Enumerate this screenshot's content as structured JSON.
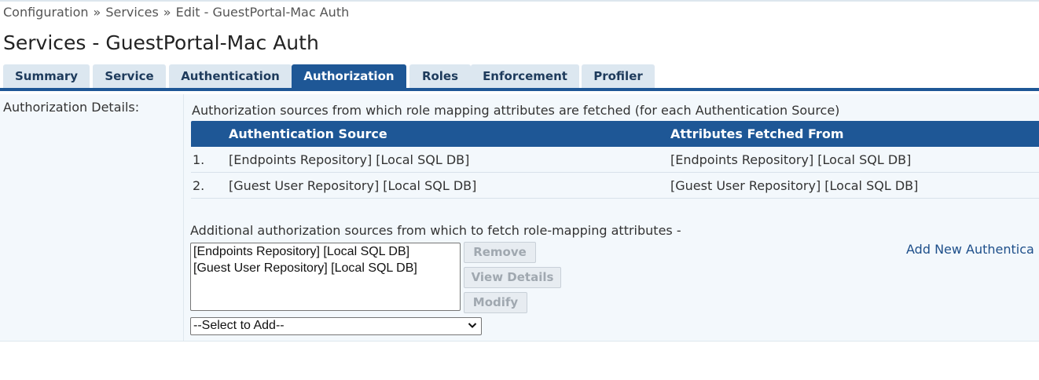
{
  "breadcrumb": {
    "items": [
      "Configuration",
      "Services",
      "Edit - GuestPortal-Mac Auth"
    ],
    "separator": "»"
  },
  "page_title": "Services - GuestPortal-Mac Auth",
  "tabs": [
    {
      "label": "Summary",
      "active": false
    },
    {
      "label": "Service",
      "active": false
    },
    {
      "label": "Authentication",
      "active": false
    },
    {
      "label": "Authorization",
      "active": true
    },
    {
      "label": "Roles",
      "active": false
    },
    {
      "label": "Enforcement",
      "active": false
    },
    {
      "label": "Profiler",
      "active": false
    }
  ],
  "authorization": {
    "section_label": "Authorization Details:",
    "intro": "Authorization sources from which role mapping attributes are fetched (for each Authentication Source)",
    "table": {
      "headers": [
        "Authentication Source",
        "Attributes Fetched From"
      ],
      "rows": [
        {
          "num": "1.",
          "source": "[Endpoints Repository] [Local SQL DB]",
          "fetched_from": "[Endpoints Repository] [Local SQL DB]"
        },
        {
          "num": "2.",
          "source": "[Guest User Repository] [Local SQL DB]",
          "fetched_from": "[Guest User Repository] [Local SQL DB]"
        }
      ]
    },
    "additional_label": "Additional authorization sources from which to fetch role-mapping attributes -",
    "listbox_options": [
      "[Endpoints Repository] [Local SQL DB]",
      "[Guest User Repository] [Local SQL DB]"
    ],
    "buttons": {
      "remove": "Remove",
      "view_details": "View Details",
      "modify": "Modify"
    },
    "add_new_link": "Add New Authentica",
    "select": {
      "value": "--Select to Add--"
    }
  },
  "colors": {
    "accent": "#1e5796",
    "tab_inactive_bg": "#dce7f0",
    "content_bg": "#f3f8fc",
    "link": "#1e4f8a"
  }
}
